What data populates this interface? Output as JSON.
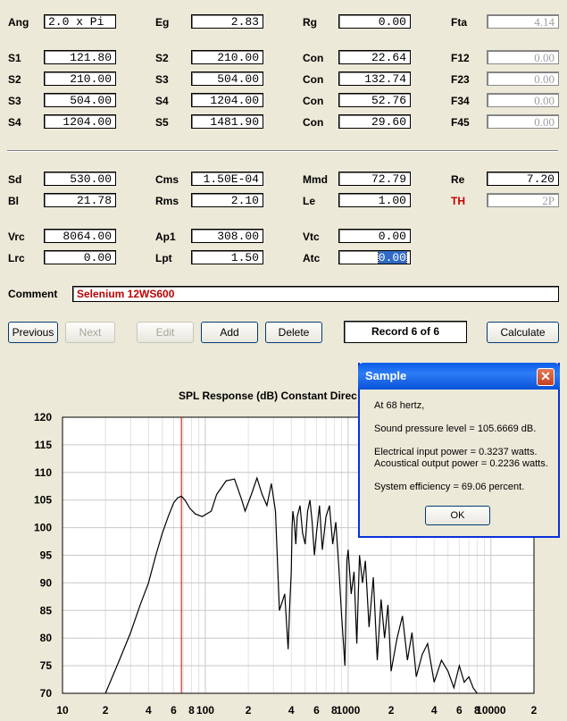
{
  "fields": {
    "row1": [
      {
        "label": "Ang",
        "value": "2.0 x Pi"
      },
      {
        "label": "Eg",
        "value": "2.83"
      },
      {
        "label": "Rg",
        "value": "0.00"
      },
      {
        "label": "Fta",
        "value": "4.14"
      }
    ],
    "segments": [
      {
        "s": "S1",
        "sv": "121.80",
        "s2": "S2",
        "s2v": "210.00",
        "con": "Con",
        "conv": "22.64",
        "f": "F12",
        "fv": "0.00"
      },
      {
        "s": "S2",
        "sv": "210.00",
        "s2": "S3",
        "s2v": "504.00",
        "con": "Con",
        "conv": "132.74",
        "f": "F23",
        "fv": "0.00"
      },
      {
        "s": "S3",
        "sv": "504.00",
        "s2": "S4",
        "s2v": "1204.00",
        "con": "Con",
        "conv": "52.76",
        "f": "F34",
        "fv": "0.00"
      },
      {
        "s": "S4",
        "sv": "1204.00",
        "s2": "S5",
        "s2v": "1481.90",
        "con": "Con",
        "conv": "29.60",
        "f": "F45",
        "fv": "0.00"
      }
    ],
    "driver1": [
      {
        "label": "Sd",
        "value": "530.00"
      },
      {
        "label": "Cms",
        "value": "1.50E-04"
      },
      {
        "label": "Mmd",
        "value": "72.79"
      },
      {
        "label": "Re",
        "value": "7.20"
      }
    ],
    "driver2": [
      {
        "label": "Bl",
        "value": "21.78"
      },
      {
        "label": "Rms",
        "value": "2.10"
      },
      {
        "label": "Le",
        "value": "1.00"
      },
      {
        "label": "TH",
        "value": "2P"
      }
    ],
    "chamber1": [
      {
        "label": "Vrc",
        "value": "8064.00"
      },
      {
        "label": "Ap1",
        "value": "308.00"
      },
      {
        "label": "Vtc",
        "value": "0.00"
      }
    ],
    "chamber2": [
      {
        "label": "Lrc",
        "value": "0.00"
      },
      {
        "label": "Lpt",
        "value": "1.50"
      },
      {
        "label": "Atc",
        "value": "0.00"
      }
    ],
    "comment": {
      "label": "Comment",
      "value": "Selenium 12WS600"
    }
  },
  "buttons": {
    "previous": "Previous",
    "next": "Next",
    "edit": "Edit",
    "add": "Add",
    "delete": "Delete",
    "calculate": "Calculate"
  },
  "record_label": "Record 6 of 6",
  "dialog": {
    "title": "Sample",
    "close": "✕",
    "line1": "At 68 hertz,",
    "line2": "Sound pressure level = 105.6669 dB.",
    "line3": "Electrical input power = 0.3237 watts.",
    "line4": "Acoustical output power = 0.2236 watts.",
    "line5": "System efficiency = 69.06 percent.",
    "ok": "OK"
  },
  "chart_data": {
    "type": "line",
    "title": "SPL Response (dB)   Constant Direc",
    "x_scale": "log",
    "xlim": [
      10,
      20000
    ],
    "ylim": [
      70,
      120
    ],
    "y_ticks": [
      70,
      75,
      80,
      85,
      90,
      95,
      100,
      105,
      110,
      115,
      120
    ],
    "x_tick_labels": [
      {
        "x": 10,
        "label": "10"
      },
      {
        "x": 20,
        "label": "2"
      },
      {
        "x": 40,
        "label": "4"
      },
      {
        "x": 60,
        "label": "6"
      },
      {
        "x": 80,
        "label": "8"
      },
      {
        "x": 100,
        "label": "100"
      },
      {
        "x": 200,
        "label": "2"
      },
      {
        "x": 400,
        "label": "4"
      },
      {
        "x": 600,
        "label": "6"
      },
      {
        "x": 800,
        "label": "8"
      },
      {
        "x": 1000,
        "label": "1000"
      },
      {
        "x": 2000,
        "label": "2"
      },
      {
        "x": 4000,
        "label": "4"
      },
      {
        "x": 6000,
        "label": "6"
      },
      {
        "x": 8000,
        "label": "8"
      },
      {
        "x": 10000,
        "label": "10000"
      },
      {
        "x": 20000,
        "label": "2"
      }
    ],
    "marker_x": 68,
    "colors": {
      "curve": "#000000",
      "marker": "#d00000",
      "grid_major": "#c8c8c8",
      "grid_minor": "#e4e4e4"
    },
    "series": [
      {
        "x": [
          20,
          25,
          30,
          35,
          40,
          45,
          50,
          55,
          60,
          64,
          68,
          72,
          78,
          85,
          95,
          110,
          120,
          140,
          160,
          180,
          190,
          210,
          230,
          250,
          270,
          290,
          310,
          330,
          360,
          380,
          390,
          400,
          405,
          410,
          420,
          430,
          440,
          460,
          480,
          500,
          520,
          540,
          560,
          580,
          600,
          630,
          660,
          700,
          740,
          780,
          820,
          860,
          900,
          950,
          980,
          1000,
          1050,
          1100,
          1150,
          1200,
          1260,
          1320,
          1400,
          1500,
          1600,
          1700,
          1800,
          1900,
          2000,
          2200,
          2400,
          2600,
          2800,
          3000,
          3300,
          3600,
          4000,
          4500,
          5000,
          5500,
          6000,
          6500,
          7000,
          7500,
          8000
        ],
        "y": [
          70,
          76,
          81,
          86,
          90,
          95,
          99,
          102,
          104.5,
          105.4,
          105.7,
          105,
          103.5,
          102.5,
          102,
          103,
          106,
          108.5,
          108.8,
          105,
          103,
          106,
          109,
          106,
          104,
          108,
          103,
          85,
          88,
          78,
          86,
          92,
          100,
          103,
          101,
          97,
          102,
          104,
          99,
          97,
          103,
          105,
          101,
          95,
          99,
          104,
          96,
          102,
          104,
          97,
          101,
          93,
          84,
          75,
          94,
          96,
          88,
          92,
          79,
          95,
          90,
          94,
          82,
          91,
          76,
          87,
          80,
          86,
          74,
          80,
          84,
          76,
          81,
          73,
          77,
          79,
          72,
          76,
          74,
          71,
          75,
          72,
          73,
          71,
          70
        ]
      }
    ]
  }
}
